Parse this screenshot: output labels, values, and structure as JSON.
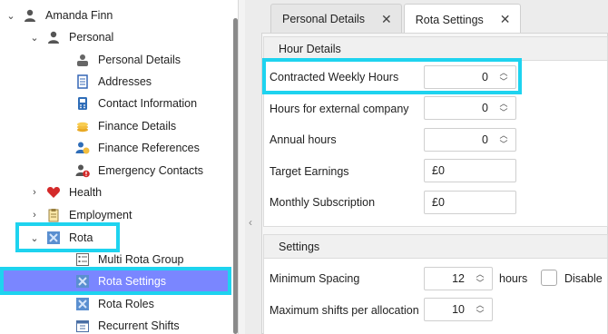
{
  "tree": {
    "root": {
      "label": "Amanda Finn",
      "icon": "person-icon"
    },
    "personal": {
      "label": "Personal",
      "icon": "person-icon"
    },
    "personal_items": [
      {
        "label": "Personal Details",
        "icon": "person-card-icon"
      },
      {
        "label": "Addresses",
        "icon": "address-book-icon"
      },
      {
        "label": "Contact Information",
        "icon": "phone-icon"
      },
      {
        "label": "Finance Details",
        "icon": "coins-icon"
      },
      {
        "label": "Finance References",
        "icon": "person-coin-icon"
      },
      {
        "label": "Emergency Contacts",
        "icon": "emergency-contact-icon"
      }
    ],
    "health": {
      "label": "Health",
      "icon": "heart-icon"
    },
    "employment": {
      "label": "Employment",
      "icon": "clipboard-icon"
    },
    "rota": {
      "label": "Rota",
      "icon": "rota-icon"
    },
    "rota_items": [
      {
        "label": "Multi Rota Group",
        "icon": "list-icon"
      },
      {
        "label": "Rota Settings",
        "icon": "rota-icon"
      },
      {
        "label": "Rota Roles",
        "icon": "rota-icon"
      },
      {
        "label": "Recurrent Shifts",
        "icon": "calendar-icon"
      }
    ]
  },
  "tabs": [
    {
      "label": "Personal Details",
      "close": "✕"
    },
    {
      "label": "Rota Settings",
      "close": "✕"
    }
  ],
  "hour_details": {
    "header": "Hour Details",
    "contracted_weekly_hours": {
      "label": "Contracted Weekly Hours",
      "value": "0"
    },
    "hours_external_company": {
      "label": "Hours for external company",
      "value": "0"
    },
    "annual_hours": {
      "label": "Annual hours",
      "value": "0"
    },
    "target_earnings": {
      "label": "Target Earnings",
      "value": "£0"
    },
    "monthly_subscription": {
      "label": "Monthly Subscription",
      "value": "£0"
    }
  },
  "settings": {
    "header": "Settings",
    "minimum_spacing": {
      "label": "Minimum Spacing",
      "value": "12",
      "suffix": "hours"
    },
    "disable_label": "Disable",
    "max_shifts": {
      "label": "Maximum shifts per allocation",
      "value": "10"
    }
  },
  "colors": {
    "highlight": "#1ed3ef",
    "selected_bg": "#7a86ff"
  }
}
